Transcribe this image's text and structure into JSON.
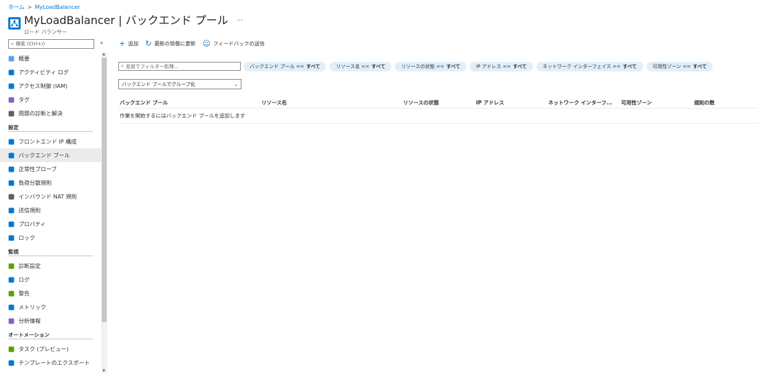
{
  "breadcrumb": {
    "home": "ホーム",
    "sep": ">",
    "current": "MyLoadBalancer"
  },
  "header": {
    "title": "MyLoadBalancer | バックエンド プール",
    "more": "···",
    "subtitle": "ロード バランサー",
    "icon": "load-balancer-icon"
  },
  "sidebar": {
    "search_placeholder": "検索 (Ctrl+/)",
    "collapse": "«",
    "items": [
      {
        "label": "概要",
        "icon": "overview-icon",
        "color": "#5ea0ef"
      },
      {
        "label": "アクティビティ ログ",
        "icon": "activity-log-icon",
        "color": "#0078d4"
      },
      {
        "label": "アクセス制御 (IAM)",
        "icon": "iam-icon",
        "color": "#0078d4"
      },
      {
        "label": "タグ",
        "icon": "tag-icon",
        "color": "#8661c5"
      },
      {
        "label": "問題の診断と解決",
        "icon": "wrench-icon",
        "color": "#605e5c"
      }
    ],
    "sections": [
      {
        "title": "設定",
        "items": [
          {
            "label": "フロントエンド IP 構成",
            "icon": "frontend-ip-icon",
            "color": "#0078d4"
          },
          {
            "label": "バックエンド プール",
            "icon": "backend-pool-icon",
            "color": "#0078d4",
            "active": true
          },
          {
            "label": "正常性プローブ",
            "icon": "health-probe-icon",
            "color": "#0078d4"
          },
          {
            "label": "負荷分散規則",
            "icon": "lb-rules-icon",
            "color": "#0078d4"
          },
          {
            "label": "インバウンド NAT 規則",
            "icon": "inbound-nat-icon",
            "color": "#605e5c"
          },
          {
            "label": "送信規則",
            "icon": "outbound-rules-icon",
            "color": "#0078d4"
          },
          {
            "label": "プロパティ",
            "icon": "properties-icon",
            "color": "#0078d4"
          },
          {
            "label": "ロック",
            "icon": "lock-icon",
            "color": "#0078d4"
          }
        ]
      },
      {
        "title": "監視",
        "items": [
          {
            "label": "診断設定",
            "icon": "diagnostic-settings-icon",
            "color": "#57a300"
          },
          {
            "label": "ログ",
            "icon": "logs-icon",
            "color": "#0078d4"
          },
          {
            "label": "警告",
            "icon": "alerts-icon",
            "color": "#57a300"
          },
          {
            "label": "メトリック",
            "icon": "metrics-icon",
            "color": "#0078d4"
          },
          {
            "label": "分析情報",
            "icon": "insights-icon",
            "color": "#8661c5"
          }
        ]
      },
      {
        "title": "オートメーション",
        "items": [
          {
            "label": "タスク (プレビュー)",
            "icon": "tasks-icon",
            "color": "#57a300"
          },
          {
            "label": "テンプレートのエクスポート",
            "icon": "export-template-icon",
            "color": "#0078d4"
          }
        ]
      }
    ]
  },
  "toolbar": {
    "add": "追加",
    "refresh": "最新の情報に更新",
    "feedback": "フィードバックの送信"
  },
  "filter": {
    "placeholder": "名前でフィルター処理...",
    "pills": [
      {
        "label": "バックエンド プール ==",
        "value": "すべて"
      },
      {
        "label": "リソース名 ==",
        "value": "すべて"
      },
      {
        "label": "リソースの状態 ==",
        "value": "すべて"
      },
      {
        "label": "IP アドレス ==",
        "value": "すべて"
      },
      {
        "label": "ネットワーク インターフェイス ==",
        "value": "すべて"
      },
      {
        "label": "可用性ゾーン ==",
        "value": "すべて"
      }
    ],
    "groupby": "バックエンド プールでグループ化"
  },
  "table": {
    "columns": [
      "バックエンド プール",
      "リソース名",
      "リソースの状態",
      "IP アドレス",
      "ネットワーク インターフ...",
      "可用性ゾーン",
      "規則の数"
    ],
    "empty_message": "作業を開始するにはバックエンド プールを追加します"
  }
}
